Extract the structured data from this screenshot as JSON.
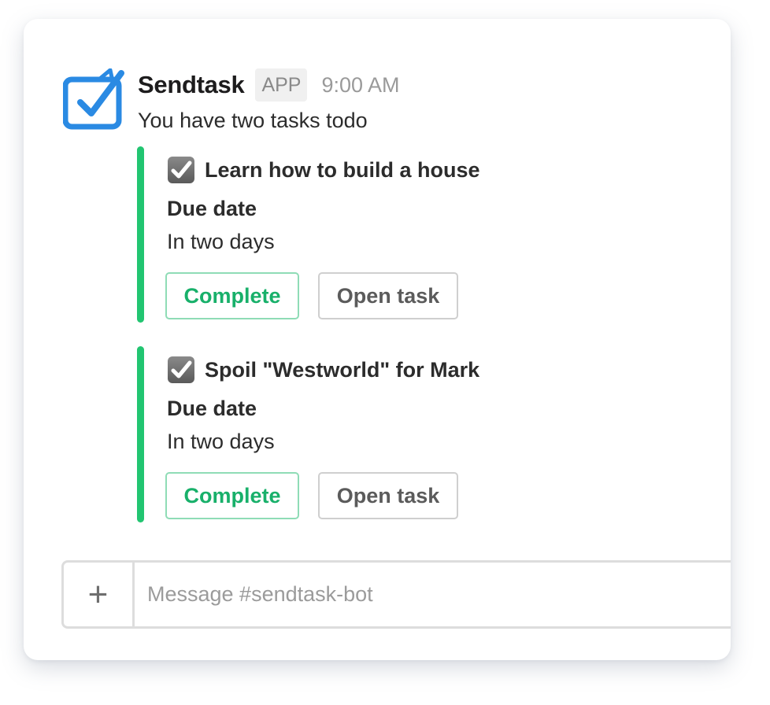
{
  "message": {
    "sender": "Sendtask",
    "badge": "APP",
    "time": "9:00 AM",
    "text": "You have two tasks todo"
  },
  "tasks": [
    {
      "title": "Learn how to build a house",
      "field_label": "Due date",
      "field_value": "In two days",
      "complete_label": "Complete",
      "open_label": "Open task"
    },
    {
      "title": "Spoil \"Westworld\" for Mark",
      "field_label": "Due date",
      "field_value": "In two days",
      "complete_label": "Complete",
      "open_label": "Open task"
    }
  ],
  "composer": {
    "add_label": "+",
    "placeholder": "Message #sendtask-bot"
  },
  "icons": {
    "avatar": "sendtask-logo-icon",
    "task_check": "checkbox-checked-icon"
  },
  "colors": {
    "accent_green": "#22c571",
    "complete_text": "#18b06a",
    "logo_blue": "#2a8ae3"
  }
}
